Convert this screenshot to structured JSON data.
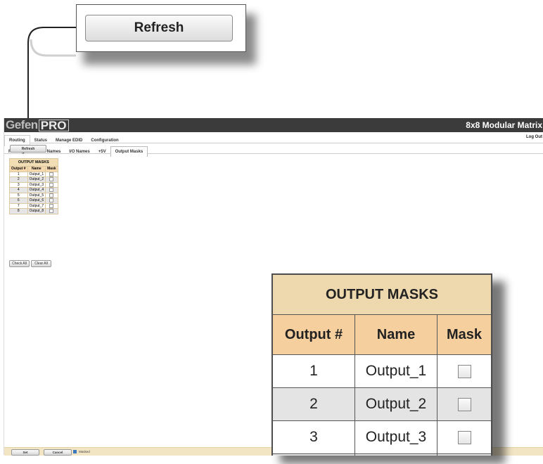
{
  "refresh_label": "Refresh",
  "app": {
    "logo_left": "Gefen",
    "logo_right": "PRO",
    "device_title": "8x8 Modular Matrix",
    "log_out": "Log Out",
    "top_tabs": [
      "Routing",
      "Status",
      "Manage EDID",
      "Configuration"
    ],
    "sub_tabs": [
      "Routing",
      "Preset Names",
      "I/O Names",
      "+5V",
      "Output Masks"
    ]
  },
  "masks": {
    "caption": "OUTPUT MASKS",
    "headers": [
      "Output #",
      "Name",
      "Mask"
    ],
    "rows": [
      {
        "num": "1",
        "name": "Output_1"
      },
      {
        "num": "2",
        "name": "Output_2"
      },
      {
        "num": "3",
        "name": "Output_3"
      },
      {
        "num": "4",
        "name": "Output_4"
      },
      {
        "num": "5",
        "name": "Output_5"
      },
      {
        "num": "6",
        "name": "Output_6"
      },
      {
        "num": "7",
        "name": "Output_7"
      },
      {
        "num": "8",
        "name": "Output_8"
      }
    ],
    "check_all": "Check All",
    "clear_all": "Clear All"
  },
  "footer": {
    "set": "Set",
    "cancel": "Cancel",
    "legend": "Masked"
  },
  "colors": {
    "header_bg": "#3b3b3b",
    "table_caption": "#eed8ad",
    "table_header": "#f6cf9e",
    "footer_bg": "#f2e5c4",
    "masked_swatch": "#3a78c2"
  }
}
